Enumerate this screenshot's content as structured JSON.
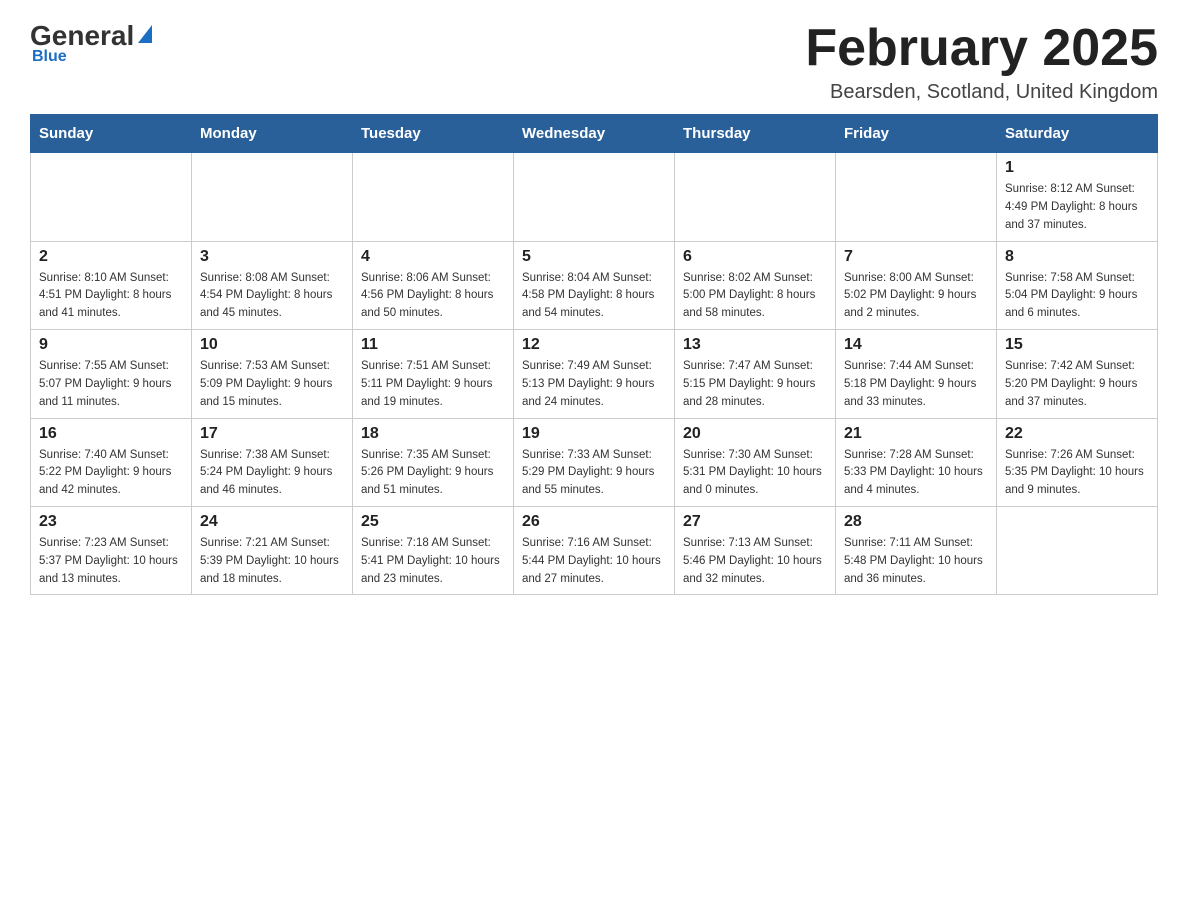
{
  "header": {
    "logo_general": "General",
    "logo_blue": "Blue",
    "title": "February 2025",
    "subtitle": "Bearsden, Scotland, United Kingdom"
  },
  "weekdays": [
    "Sunday",
    "Monday",
    "Tuesday",
    "Wednesday",
    "Thursday",
    "Friday",
    "Saturday"
  ],
  "weeks": [
    [
      {
        "day": "",
        "info": ""
      },
      {
        "day": "",
        "info": ""
      },
      {
        "day": "",
        "info": ""
      },
      {
        "day": "",
        "info": ""
      },
      {
        "day": "",
        "info": ""
      },
      {
        "day": "",
        "info": ""
      },
      {
        "day": "1",
        "info": "Sunrise: 8:12 AM\nSunset: 4:49 PM\nDaylight: 8 hours\nand 37 minutes."
      }
    ],
    [
      {
        "day": "2",
        "info": "Sunrise: 8:10 AM\nSunset: 4:51 PM\nDaylight: 8 hours\nand 41 minutes."
      },
      {
        "day": "3",
        "info": "Sunrise: 8:08 AM\nSunset: 4:54 PM\nDaylight: 8 hours\nand 45 minutes."
      },
      {
        "day": "4",
        "info": "Sunrise: 8:06 AM\nSunset: 4:56 PM\nDaylight: 8 hours\nand 50 minutes."
      },
      {
        "day": "5",
        "info": "Sunrise: 8:04 AM\nSunset: 4:58 PM\nDaylight: 8 hours\nand 54 minutes."
      },
      {
        "day": "6",
        "info": "Sunrise: 8:02 AM\nSunset: 5:00 PM\nDaylight: 8 hours\nand 58 minutes."
      },
      {
        "day": "7",
        "info": "Sunrise: 8:00 AM\nSunset: 5:02 PM\nDaylight: 9 hours\nand 2 minutes."
      },
      {
        "day": "8",
        "info": "Sunrise: 7:58 AM\nSunset: 5:04 PM\nDaylight: 9 hours\nand 6 minutes."
      }
    ],
    [
      {
        "day": "9",
        "info": "Sunrise: 7:55 AM\nSunset: 5:07 PM\nDaylight: 9 hours\nand 11 minutes."
      },
      {
        "day": "10",
        "info": "Sunrise: 7:53 AM\nSunset: 5:09 PM\nDaylight: 9 hours\nand 15 minutes."
      },
      {
        "day": "11",
        "info": "Sunrise: 7:51 AM\nSunset: 5:11 PM\nDaylight: 9 hours\nand 19 minutes."
      },
      {
        "day": "12",
        "info": "Sunrise: 7:49 AM\nSunset: 5:13 PM\nDaylight: 9 hours\nand 24 minutes."
      },
      {
        "day": "13",
        "info": "Sunrise: 7:47 AM\nSunset: 5:15 PM\nDaylight: 9 hours\nand 28 minutes."
      },
      {
        "day": "14",
        "info": "Sunrise: 7:44 AM\nSunset: 5:18 PM\nDaylight: 9 hours\nand 33 minutes."
      },
      {
        "day": "15",
        "info": "Sunrise: 7:42 AM\nSunset: 5:20 PM\nDaylight: 9 hours\nand 37 minutes."
      }
    ],
    [
      {
        "day": "16",
        "info": "Sunrise: 7:40 AM\nSunset: 5:22 PM\nDaylight: 9 hours\nand 42 minutes."
      },
      {
        "day": "17",
        "info": "Sunrise: 7:38 AM\nSunset: 5:24 PM\nDaylight: 9 hours\nand 46 minutes."
      },
      {
        "day": "18",
        "info": "Sunrise: 7:35 AM\nSunset: 5:26 PM\nDaylight: 9 hours\nand 51 minutes."
      },
      {
        "day": "19",
        "info": "Sunrise: 7:33 AM\nSunset: 5:29 PM\nDaylight: 9 hours\nand 55 minutes."
      },
      {
        "day": "20",
        "info": "Sunrise: 7:30 AM\nSunset: 5:31 PM\nDaylight: 10 hours\nand 0 minutes."
      },
      {
        "day": "21",
        "info": "Sunrise: 7:28 AM\nSunset: 5:33 PM\nDaylight: 10 hours\nand 4 minutes."
      },
      {
        "day": "22",
        "info": "Sunrise: 7:26 AM\nSunset: 5:35 PM\nDaylight: 10 hours\nand 9 minutes."
      }
    ],
    [
      {
        "day": "23",
        "info": "Sunrise: 7:23 AM\nSunset: 5:37 PM\nDaylight: 10 hours\nand 13 minutes."
      },
      {
        "day": "24",
        "info": "Sunrise: 7:21 AM\nSunset: 5:39 PM\nDaylight: 10 hours\nand 18 minutes."
      },
      {
        "day": "25",
        "info": "Sunrise: 7:18 AM\nSunset: 5:41 PM\nDaylight: 10 hours\nand 23 minutes."
      },
      {
        "day": "26",
        "info": "Sunrise: 7:16 AM\nSunset: 5:44 PM\nDaylight: 10 hours\nand 27 minutes."
      },
      {
        "day": "27",
        "info": "Sunrise: 7:13 AM\nSunset: 5:46 PM\nDaylight: 10 hours\nand 32 minutes."
      },
      {
        "day": "28",
        "info": "Sunrise: 7:11 AM\nSunset: 5:48 PM\nDaylight: 10 hours\nand 36 minutes."
      },
      {
        "day": "",
        "info": ""
      }
    ]
  ]
}
